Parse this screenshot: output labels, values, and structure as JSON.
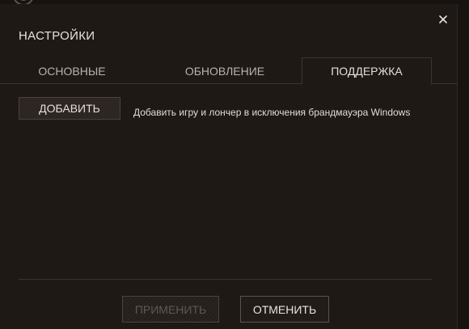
{
  "dialog": {
    "title": "НАСТРОЙКИ",
    "close_icon": "close-icon"
  },
  "tabs": [
    {
      "label": "ОСНОВНЫЕ",
      "active": false
    },
    {
      "label": "ОБНОВЛЕНИЕ",
      "active": false
    },
    {
      "label": "ПОДДЕРЖКА",
      "active": true
    }
  ],
  "support": {
    "add_button_label": "ДОБАВИТЬ",
    "add_description": "Добавить игру и лончер в исключения брандмауэра Windows"
  },
  "footer": {
    "apply_label": "ПРИМЕНИТЬ",
    "apply_enabled": false,
    "cancel_label": "ОТМЕНИТЬ"
  },
  "colors": {
    "dialog_background": "#1e1915",
    "text_primary": "#e4dfda",
    "text_disabled": "#5e5853",
    "border": "#3a342f"
  }
}
